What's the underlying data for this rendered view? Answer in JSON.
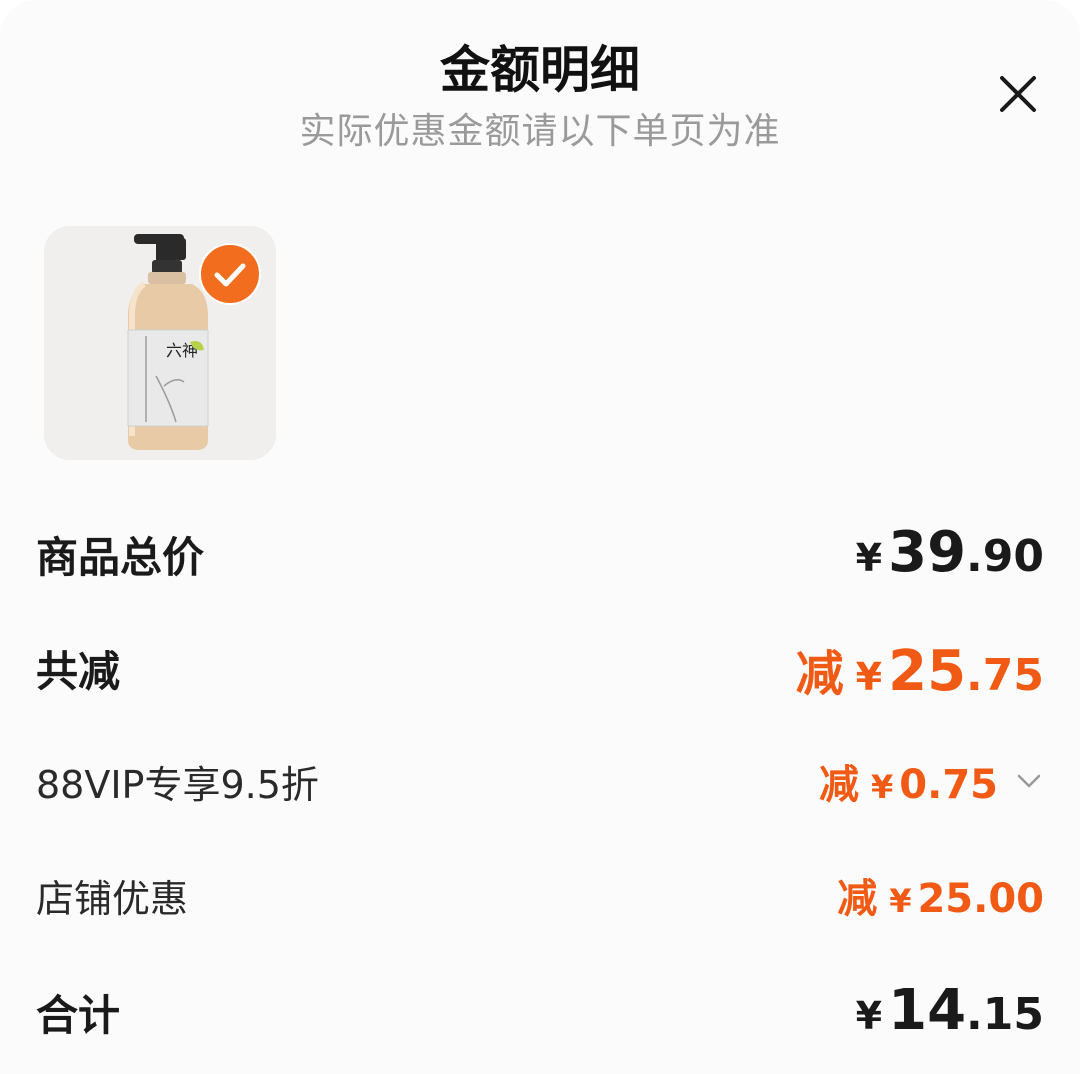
{
  "header": {
    "title": "金额明细",
    "subtitle": "实际优惠金额请以下单页为准",
    "close_icon": "close-icon"
  },
  "product": {
    "image_icon": "product-bottle-image",
    "selected": true,
    "check_icon": "check-circle-icon"
  },
  "rows": {
    "total": {
      "label": "商品总价",
      "yen": "¥",
      "int": "39",
      "dec": ".90"
    },
    "discount": {
      "label": "共减",
      "prefix": "减",
      "yen": "¥",
      "int": "25",
      "dec": ".75"
    },
    "vip": {
      "label": "88VIP专享9.5折",
      "prefix": "减",
      "yen": "¥",
      "int": "0",
      "dec": ".75",
      "expand_icon": "chevron-down-icon"
    },
    "shop": {
      "label": "店铺优惠",
      "prefix": "减",
      "yen": "¥",
      "int": "25",
      "dec": ".00"
    },
    "sum": {
      "label": "合计",
      "yen": "¥",
      "int": "14",
      "dec": ".15"
    }
  },
  "colors": {
    "accent": "#f05a14",
    "text": "#1a1a1a",
    "muted": "#9a9a9a"
  }
}
